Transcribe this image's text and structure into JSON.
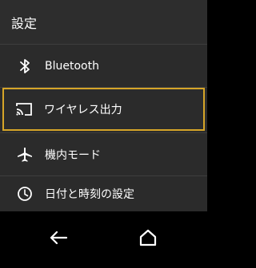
{
  "header": {
    "title": "設定"
  },
  "menu": {
    "items": [
      {
        "label": "Bluetooth",
        "icon": "bluetooth-icon"
      },
      {
        "label": "ワイヤレス出力",
        "icon": "cast-icon",
        "highlighted": true
      },
      {
        "label": "機内モード",
        "icon": "airplane-icon"
      },
      {
        "label": "日付と時刻の設定",
        "icon": "clock-icon"
      }
    ]
  },
  "navigation": {
    "back_icon": "back-arrow-icon",
    "home_icon": "home-icon"
  },
  "colors": {
    "background": "#2b2b2b",
    "text": "#ffffff",
    "highlight_border": "#d6a528",
    "navbar": "#000000"
  }
}
